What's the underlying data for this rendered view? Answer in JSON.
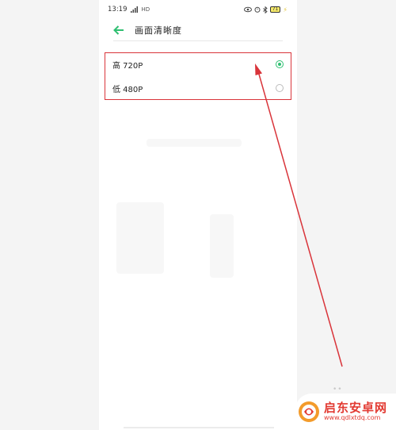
{
  "status_bar": {
    "time": "13:19",
    "network_type": "HD",
    "battery_level": "71"
  },
  "header": {
    "title": "画面清晰度",
    "back_icon": "arrow-left-icon"
  },
  "options": [
    {
      "label": "高 720P",
      "selected": true
    },
    {
      "label": "低 480P",
      "selected": false
    }
  ],
  "colors": {
    "accent": "#2fbf71",
    "annotation": "#d9343a"
  },
  "watermark": {
    "name": "启东安卓网",
    "url": "www.qdlxtdq.com"
  }
}
